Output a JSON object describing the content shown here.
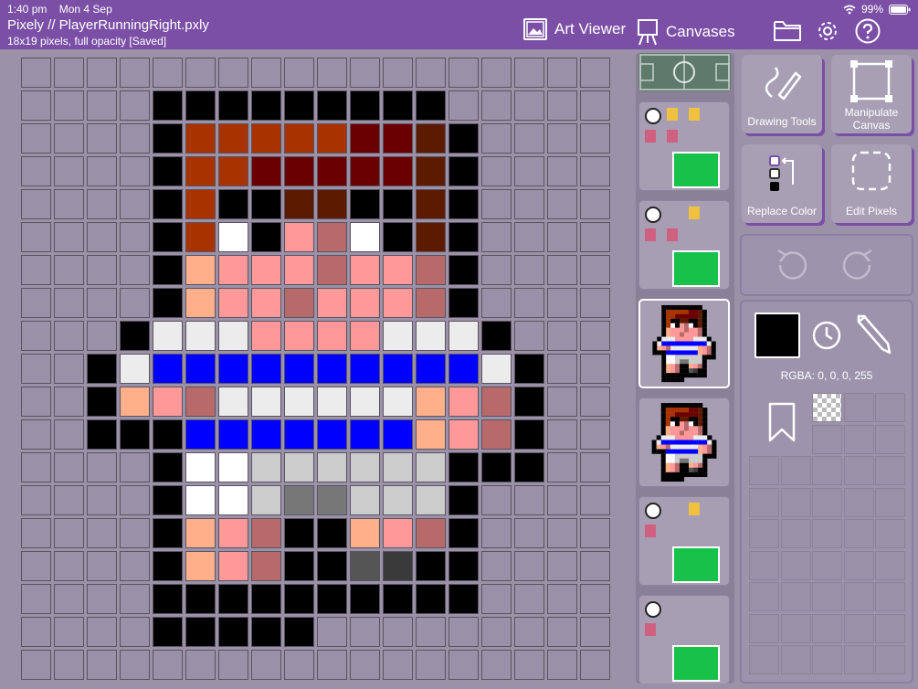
{
  "status": {
    "time": "1:40 pm",
    "date": "Mon 4 Sep",
    "battery": "99%"
  },
  "app": {
    "title": "Pixely // PlayerRunningRight.pxly",
    "subtitle": "18x19 pixels, full opacity [Saved]"
  },
  "nav": {
    "art_viewer": "Art Viewer",
    "canvases": "Canvases",
    "art_viewer_icon": "image-icon",
    "canvases_icon": "easel-icon",
    "folder_icon": "folder-icon",
    "settings_icon": "gear-icon",
    "help_icon": "help-icon"
  },
  "tools": {
    "drawing": "Drawing Tools",
    "manipulate": "Manipulate Canvas",
    "replace": "Replace Color",
    "edit_pixels": "Edit Pixels"
  },
  "color": {
    "rgba_label": "RGBA: 0, 0, 0, 255",
    "current": "#000000"
  },
  "colors": {
    "accent": "#7b4fa6",
    "empty": "#9a90a8"
  },
  "palette": {
    "K": "#000000",
    "R": "#a83200",
    "D": "#6b0000",
    "M": "#780000",
    "B": "#5c1b00",
    "W": "#ffffff",
    "P": "#ff9999",
    "Q": "#b86a6a",
    "S": "#ffb08a",
    "G": "#ececec",
    "L": "#0000ff",
    "H": "#cccccc",
    "E": "#777777",
    "A": "#555555",
    "C": "#3a3a3a"
  },
  "pixels": [
    "..................",
    "....KKKKKKKKK.....",
    "....KRRRRRDDBK....",
    "....KRRDDDDDBK....",
    "....KRKKBBKKBK....",
    "....KRWKPQWKBK....",
    "....KSPPPQPPQK....",
    "....KSPPQPPPQK....",
    "...KGGGPPPPGGGK...",
    "..KGLLLLLLLLLLGK..",
    "..KSPQGGGGGGSPQK..",
    "..KKKLLLLLLLSPQK..",
    "....KWWHHHHHHKKK..",
    "....KWWHEEHHHK....",
    "....KSPQKKSPQK....",
    "....KSPQKKACKK....",
    "....KKKKKKKKKK....",
    "....KKKKK.........",
    ".................."
  ]
}
